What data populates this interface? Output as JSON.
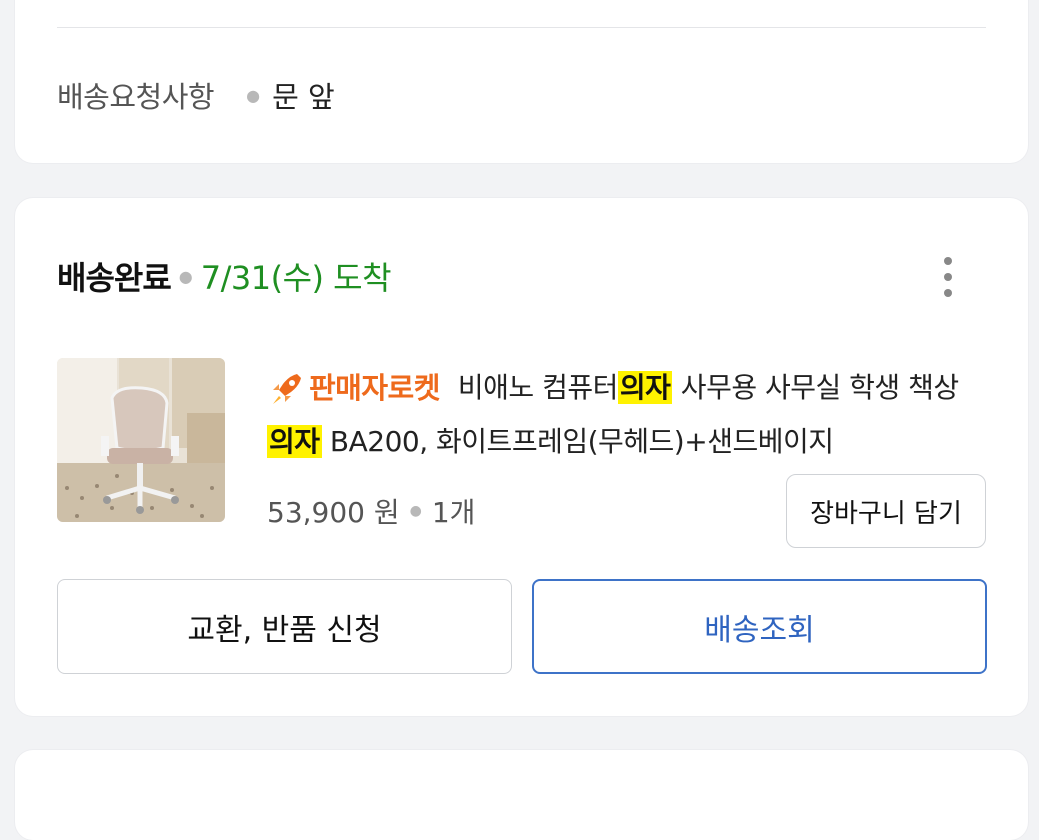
{
  "delivery_request": {
    "label": "배송요청사항",
    "value": "문 앞"
  },
  "order": {
    "status": "배송완료",
    "arrival": "7/31(수) 도착",
    "badge": "판매자로켓",
    "title_parts": [
      "비애노 컴퓨터",
      "의자",
      " 사무용 사무실 학생 책상 ",
      "의자",
      " BA200, 화이트프레임(무헤드)+샌드베이지"
    ],
    "price": "53,900 원",
    "quantity": "1개",
    "cart_button": "장바구니 담기",
    "exchange_button": "교환, 반품 신청",
    "track_button": "배송조회"
  },
  "colors": {
    "status_date": "#1f8f22",
    "badge": "#ee6a1c",
    "highlight": "#fff200",
    "track_button": "#2f64c0"
  },
  "icons": {
    "more": "more-vertical-icon",
    "badge": "rocket-icon"
  }
}
